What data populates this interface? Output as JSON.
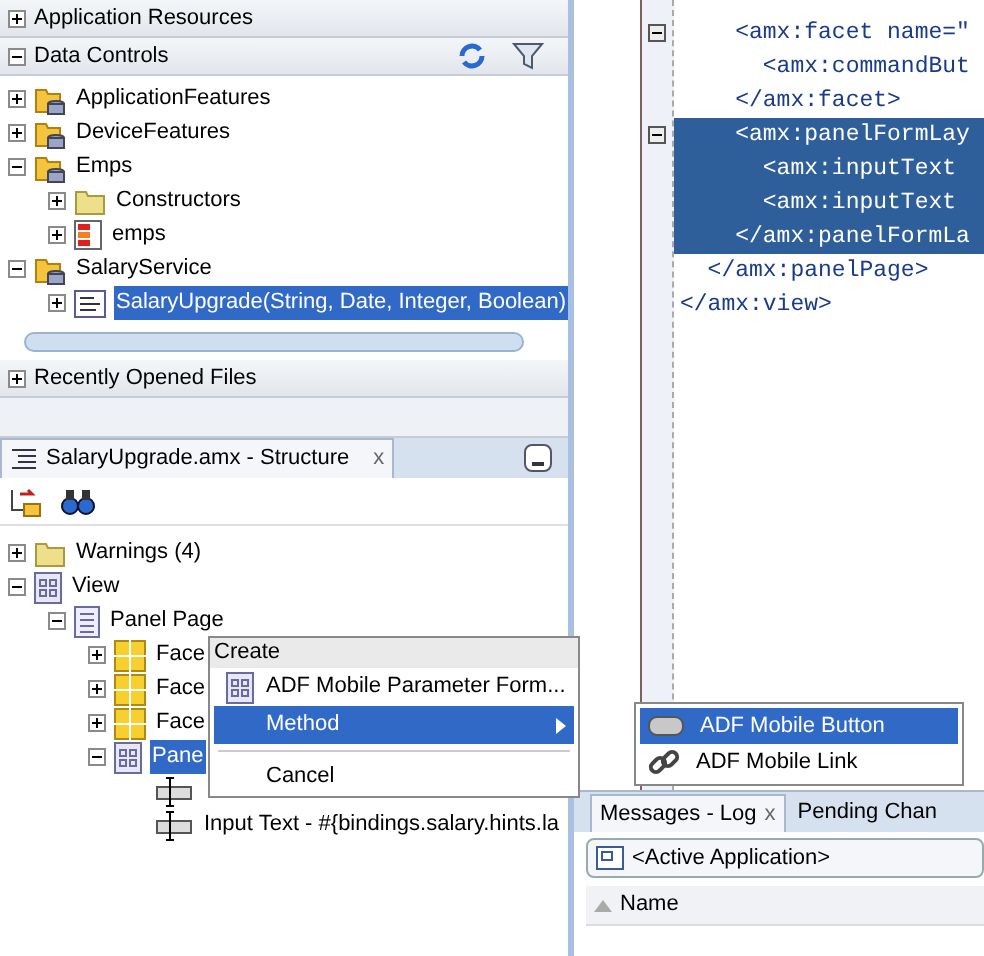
{
  "resources_panel": {
    "application_resources": {
      "label": "Application Resources",
      "expanded": false
    },
    "data_controls": {
      "label": "Data Controls",
      "expanded": true,
      "tree": [
        {
          "label": "ApplicationFeatures",
          "kind": "datacontrol",
          "expanded": false,
          "selected": false
        },
        {
          "label": "DeviceFeatures",
          "kind": "datacontrol",
          "expanded": false,
          "selected": false
        },
        {
          "label": "Emps",
          "kind": "datacontrol",
          "expanded": true,
          "selected": false,
          "children": [
            {
              "label": "Constructors",
              "kind": "folder",
              "expanded": false,
              "selected": false
            },
            {
              "label": "emps",
              "kind": "collection",
              "expanded": false,
              "selected": false
            }
          ]
        },
        {
          "label": "SalaryService",
          "kind": "datacontrol",
          "expanded": true,
          "selected": false,
          "children": [
            {
              "label": "SalaryUpgrade(String, Date, Integer, Boolean)",
              "kind": "method",
              "expanded": false,
              "selected": true
            }
          ]
        }
      ]
    },
    "recently_opened": {
      "label": "Recently Opened Files",
      "expanded": false
    }
  },
  "structure_panel": {
    "tab": {
      "label": "SalaryUpgrade.amx - Structure",
      "close": "x"
    },
    "tree": [
      {
        "label": "Warnings (4)",
        "kind": "folder",
        "expanded": false,
        "selected": false
      },
      {
        "label": "View",
        "kind": "view",
        "expanded": true,
        "selected": false,
        "children": [
          {
            "label": "Panel Page",
            "kind": "page",
            "expanded": true,
            "selected": false,
            "children": [
              {
                "label": "Face",
                "kind": "facet",
                "expanded": false,
                "selected": false
              },
              {
                "label": "Face",
                "kind": "facet",
                "expanded": false,
                "selected": false
              },
              {
                "label": "Face",
                "kind": "facet",
                "expanded": false,
                "selected": false
              },
              {
                "label": "Pane",
                "kind": "panel",
                "expanded": true,
                "selected": true,
                "children": [
                  {
                    "kind": "input"
                  },
                  {
                    "label": "Input Text - #{bindings.salary.hints.la",
                    "kind": "input",
                    "selected": false
                  }
                ]
              }
            ]
          }
        ]
      }
    ]
  },
  "editor": {
    "lines": [
      {
        "text": "    <amx:facet name=\"",
        "fold": true,
        "selected": false
      },
      {
        "text": "      <amx:commandBut",
        "fold": false,
        "selected": false
      },
      {
        "text": "    </amx:facet>",
        "fold": false,
        "selected": false
      },
      {
        "text": "    <amx:panelFormLay",
        "fold": true,
        "selected": true
      },
      {
        "text": "      <amx:inputText",
        "fold": false,
        "selected": true
      },
      {
        "text": "      <amx:inputText",
        "fold": false,
        "selected": true
      },
      {
        "text": "    </amx:panelFormLa",
        "fold": false,
        "selected": true
      },
      {
        "text": "  </amx:panelPage>",
        "fold": false,
        "selected": false
      },
      {
        "text": "</amx:view>",
        "fold": false,
        "selected": false
      }
    ]
  },
  "log_panel": {
    "tabs": [
      {
        "label": "Messages - Log",
        "close": "x",
        "selected": true
      },
      {
        "label": "Pending Chan",
        "selected": false
      }
    ],
    "scope": "<Active Application>",
    "column": "Name"
  },
  "context_menu": {
    "items": [
      {
        "kind": "header",
        "label": "Create"
      },
      {
        "kind": "item",
        "label": "ADF Mobile Parameter Form...",
        "icon": true,
        "selected": false
      },
      {
        "kind": "item",
        "label": "Method",
        "selected": true,
        "submenu": true
      },
      {
        "kind": "separator"
      },
      {
        "kind": "item",
        "label": "Cancel",
        "selected": false
      }
    ]
  },
  "submenu": {
    "items": [
      {
        "label": "ADF Mobile Button",
        "kind": "button",
        "selected": true
      },
      {
        "label": "ADF Mobile Link",
        "kind": "link",
        "selected": false
      }
    ]
  }
}
